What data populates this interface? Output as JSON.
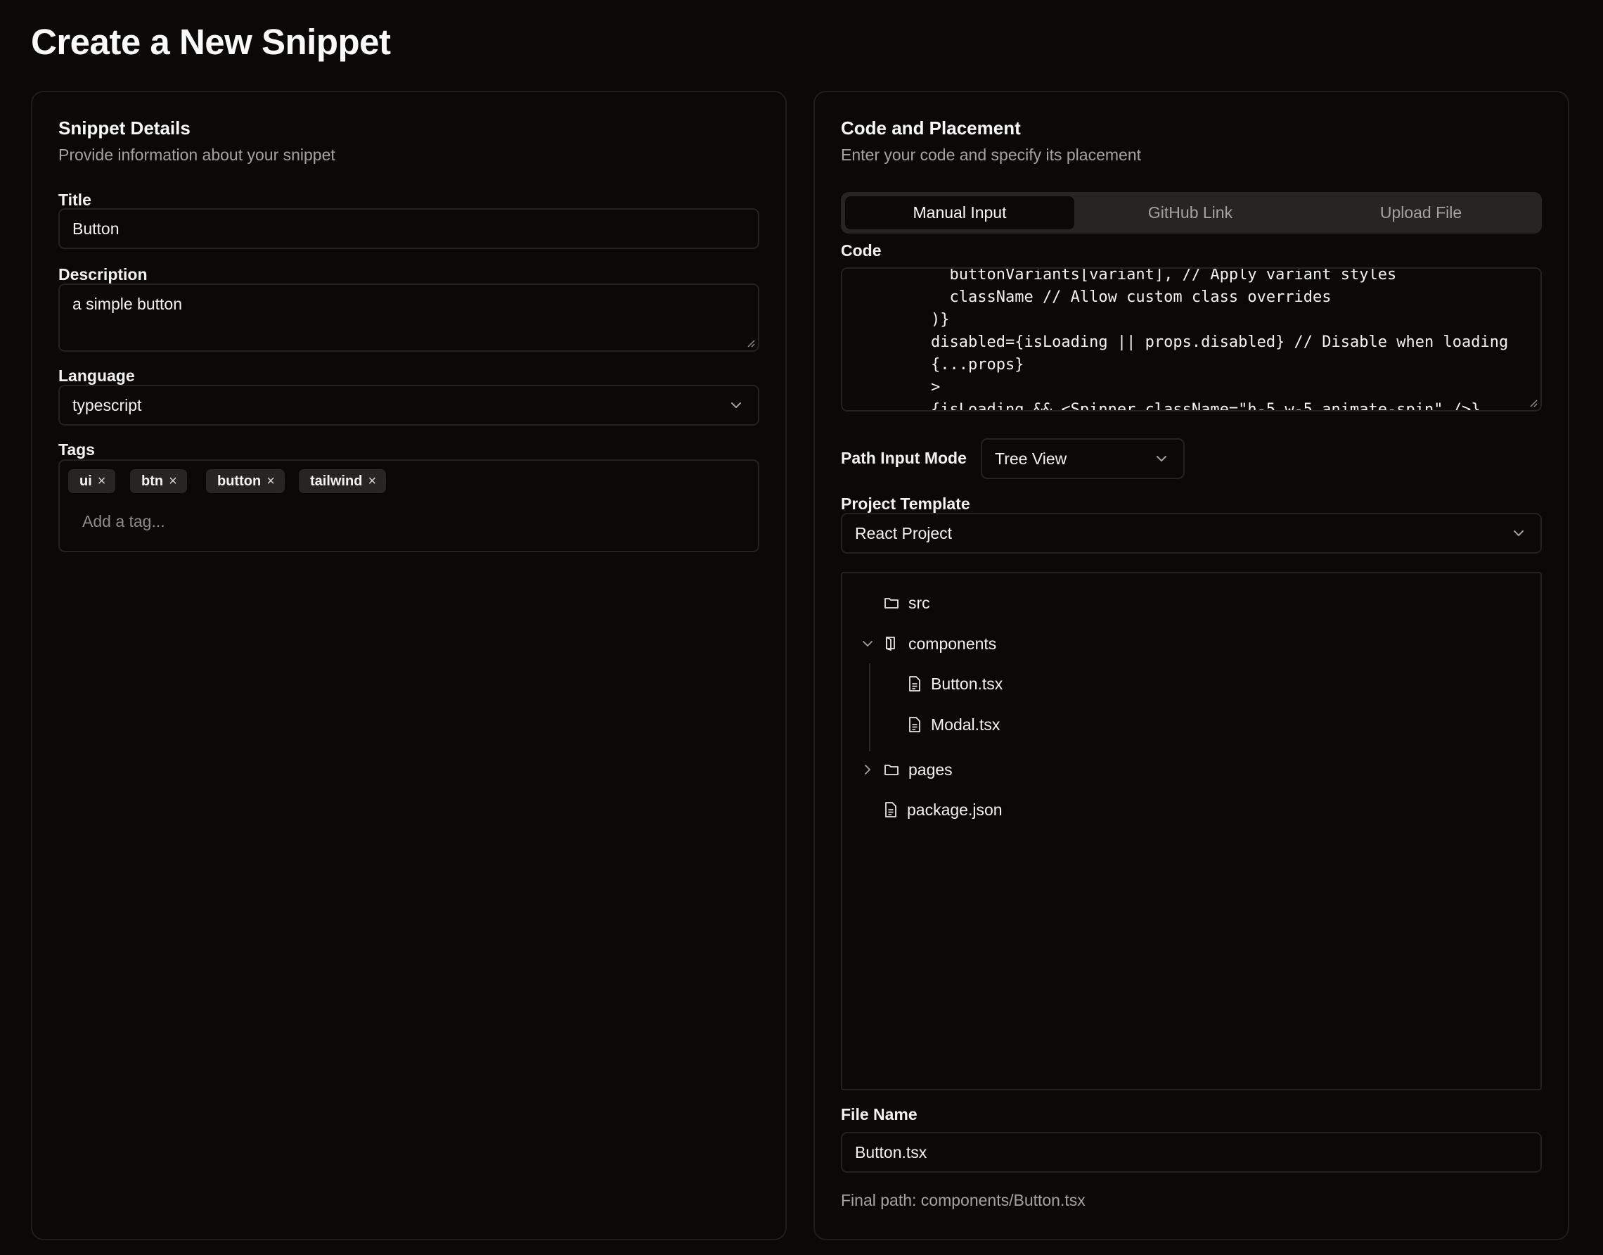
{
  "page": {
    "title": "Create a New Snippet"
  },
  "details": {
    "title": "Snippet Details",
    "subtitle": "Provide information about your snippet",
    "title_label": "Title",
    "title_value": "Button",
    "description_label": "Description",
    "description_value": "a simple button",
    "language_label": "Language",
    "language_value": "typescript",
    "tags_label": "Tags",
    "tags": [
      "ui",
      "btn",
      "button",
      "tailwind"
    ],
    "tag_placeholder": "Add a tag...",
    "tag_remove": "×"
  },
  "code": {
    "title": "Code and Placement",
    "subtitle": "Enter your code and specify its placement",
    "tabs": [
      "Manual Input",
      "GitHub Link",
      "Upload File"
    ],
    "active_tab": "Manual Input",
    "code_label": "Code",
    "code_value": "  buttonVariants[variant], // Apply variant styles\n  className // Allow custom class overrides\n)}\ndisabled={isLoading || props.disabled} // Disable when loading\n{...props}\n>\n{isLoading && <Spinner className=\"h-5 w-5 animate-spin\" />}",
    "path_mode_label": "Path Input Mode",
    "path_mode_value": "Tree View",
    "template_label": "Project Template",
    "template_value": "React Project",
    "tree": {
      "src": "src",
      "components": "components",
      "button_file": "Button.tsx",
      "modal_file": "Modal.tsx",
      "pages": "pages",
      "package": "package.json"
    },
    "file_name_label": "File Name",
    "file_name_value": "Button.tsx",
    "final_path": "Final path: components/Button.tsx"
  }
}
